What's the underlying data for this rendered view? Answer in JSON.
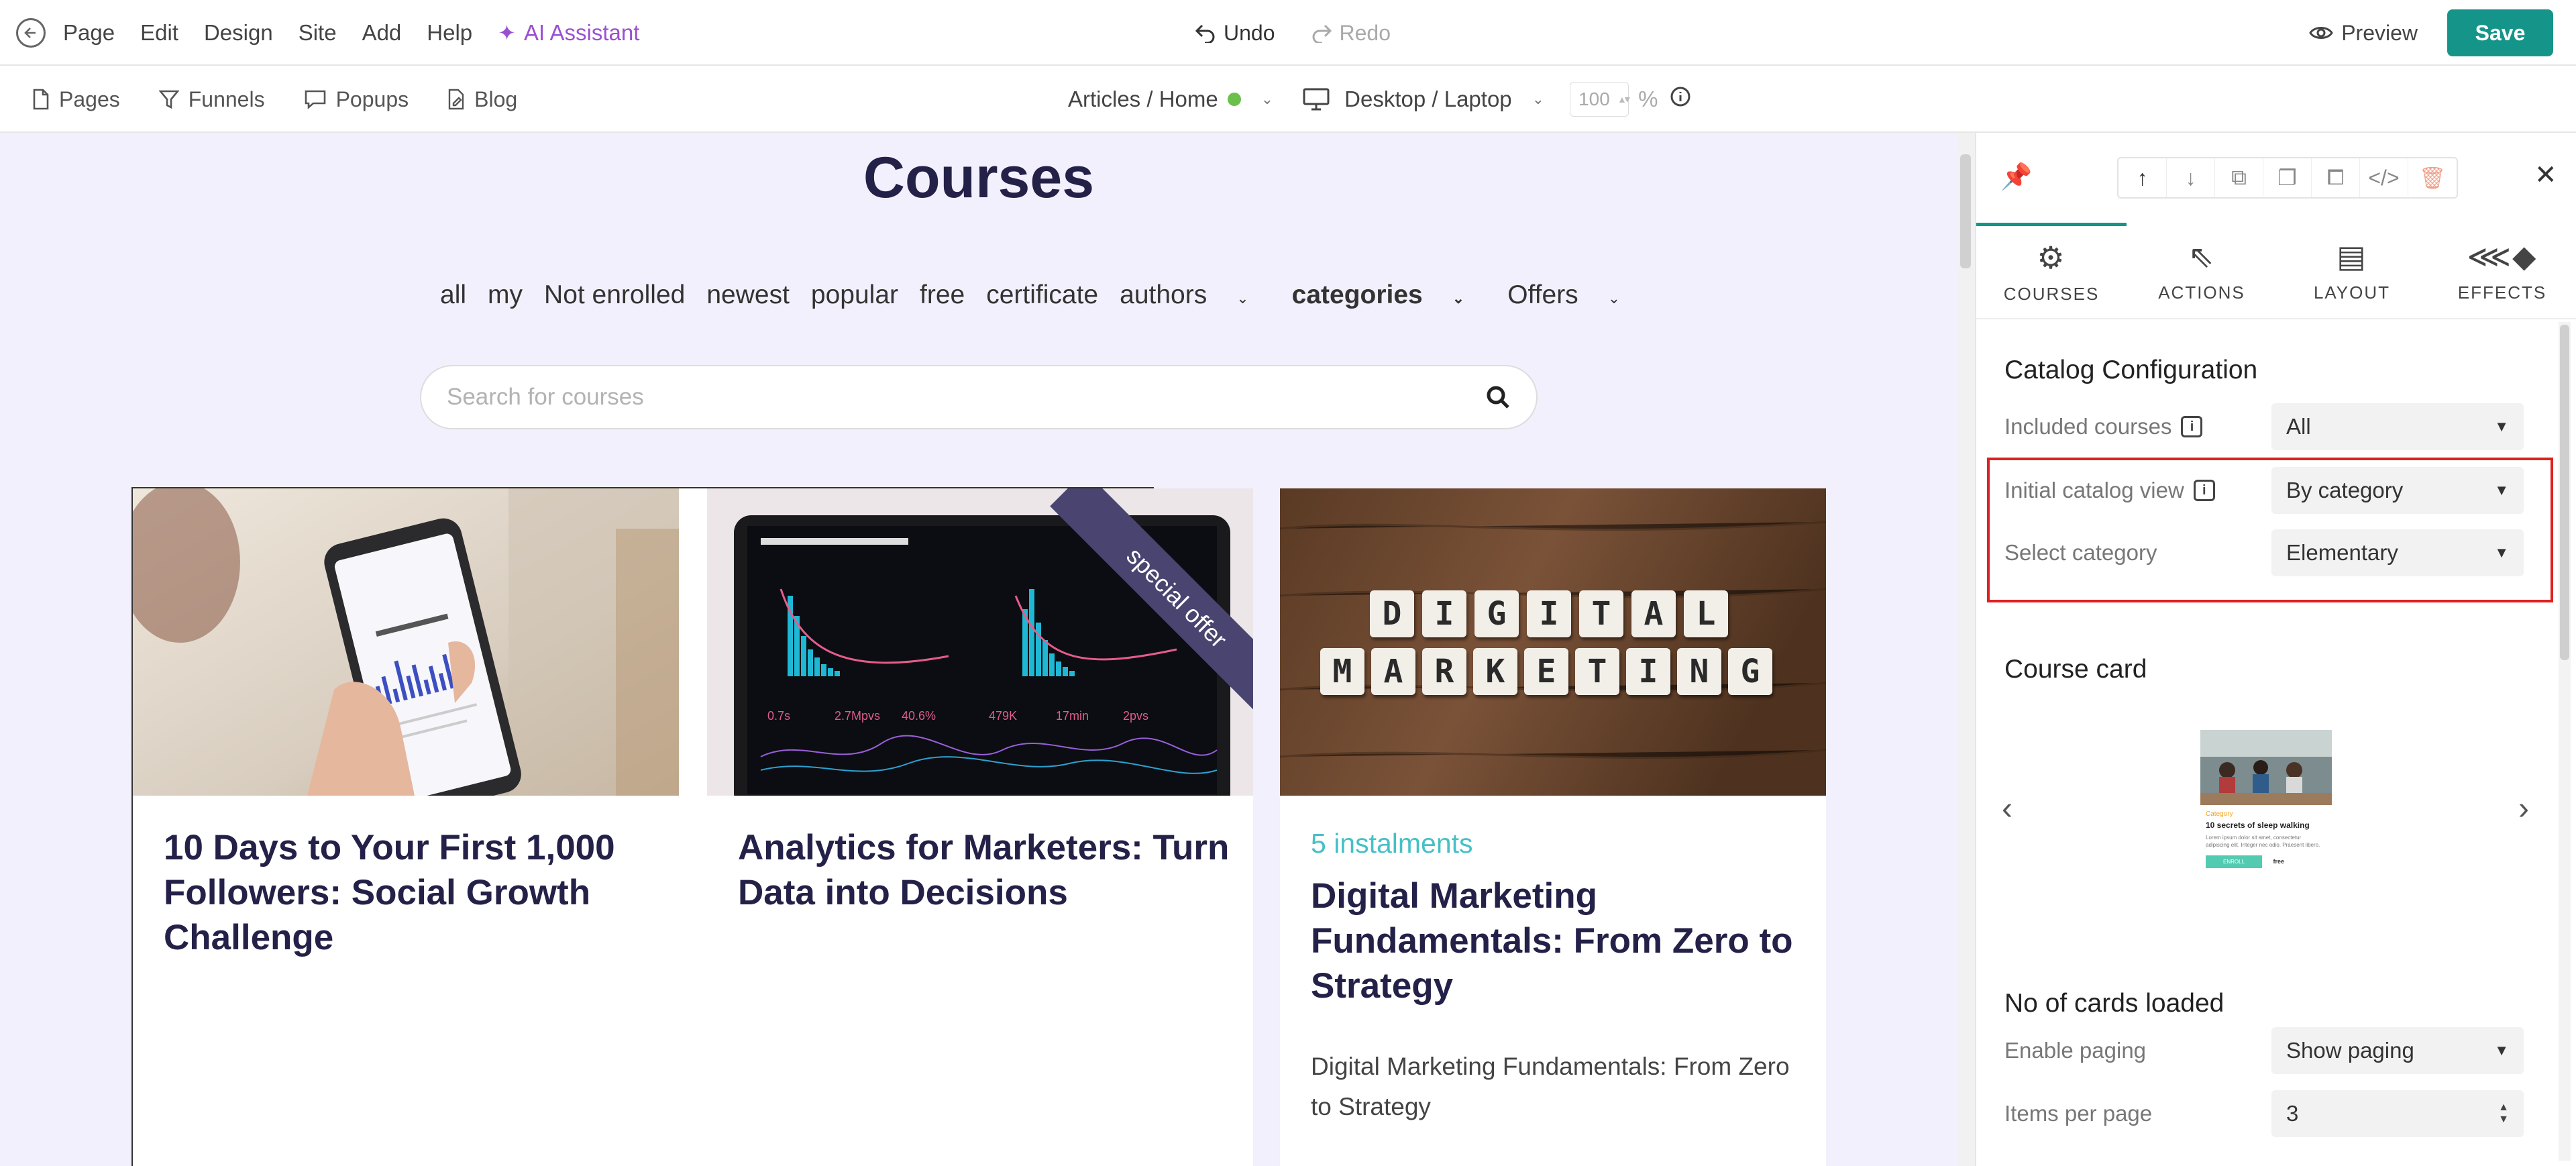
{
  "topbar": {
    "menu": [
      "Page",
      "Edit",
      "Design",
      "Site",
      "Add",
      "Help"
    ],
    "ai_assistant": "AI Assistant",
    "undo": "Undo",
    "redo": "Redo",
    "preview": "Preview",
    "save": "Save"
  },
  "subbar": {
    "items": [
      "Pages",
      "Funnels",
      "Popups",
      "Blog"
    ],
    "page_selector": "Articles / Home",
    "device": "Desktop / Laptop",
    "zoom": "100",
    "zoom_unit": "%"
  },
  "canvas": {
    "title": "Courses",
    "filters": [
      {
        "label": "all",
        "dropdown": false
      },
      {
        "label": "my",
        "dropdown": false
      },
      {
        "label": "Not enrolled",
        "dropdown": false
      },
      {
        "label": "newest",
        "dropdown": false
      },
      {
        "label": "popular",
        "dropdown": false
      },
      {
        "label": "free",
        "dropdown": false
      },
      {
        "label": "certificate",
        "dropdown": false
      },
      {
        "label": "authors",
        "dropdown": true
      },
      {
        "label": "categories",
        "dropdown": true
      },
      {
        "label": "Offers",
        "dropdown": true
      }
    ],
    "search_placeholder": "Search for courses",
    "cards": [
      {
        "title": "10 Days to Your First 1,000 Followers: Social Growth Challenge",
        "tag": "",
        "description": "",
        "ribbon": "",
        "image": "phone-analytics-photo"
      },
      {
        "title": "Analytics for Marketers: Turn Data into Decisions",
        "tag": "",
        "description": "",
        "ribbon": "special offer",
        "image": "tablet-dashboard-photo"
      },
      {
        "title": "Digital Marketing Fundamentals: From Zero to Strategy",
        "tag": "5 instalments",
        "description": "Digital Marketing Fundamentals: From Zero to Strategy",
        "ribbon": "",
        "image": "digital-marketing-tiles-photo"
      }
    ],
    "tile_row1": [
      "D",
      "I",
      "G",
      "I",
      "T",
      "A",
      "L"
    ],
    "tile_row2": [
      "M",
      "A",
      "R",
      "K",
      "E",
      "T",
      "I",
      "N",
      "G"
    ]
  },
  "panel": {
    "tabs": [
      {
        "label": "COURSES",
        "icon": "gear-icon",
        "active": true
      },
      {
        "label": "ACTIONS",
        "icon": "cursor-click-icon",
        "active": false
      },
      {
        "label": "LAYOUT",
        "icon": "layout-icon",
        "active": false
      },
      {
        "label": "EFFECTS",
        "icon": "effects-icon",
        "active": false
      }
    ],
    "catalog_title": "Catalog Configuration",
    "included_courses_label": "Included courses",
    "included_courses_value": "All",
    "initial_view_label": "Initial catalog view",
    "initial_view_value": "By category",
    "select_category_label": "Select category",
    "select_category_value": "Elementary",
    "course_card_title": "Course card",
    "thumb": {
      "category": "Category",
      "title": "10 secrets of sleep walking",
      "text": "Lorem ipsum dolor sit amet, consectetur adipiscing elit. Integer nec odio. Praesent libero.",
      "button": "ENROLL",
      "price": "free"
    },
    "cards_loaded_title": "No of cards loaded",
    "paging_label": "Enable paging",
    "paging_value": "Show paging",
    "items_per_page_label": "Items per page",
    "items_per_page_value": "3"
  },
  "colors": {
    "accent": "#15958a",
    "ai": "#9b4fd1",
    "canvas_bg": "#f3f0fd",
    "title": "#242149",
    "tag": "#46c0c6",
    "highlight": "#e02020",
    "ribbon": "#4a4470"
  }
}
